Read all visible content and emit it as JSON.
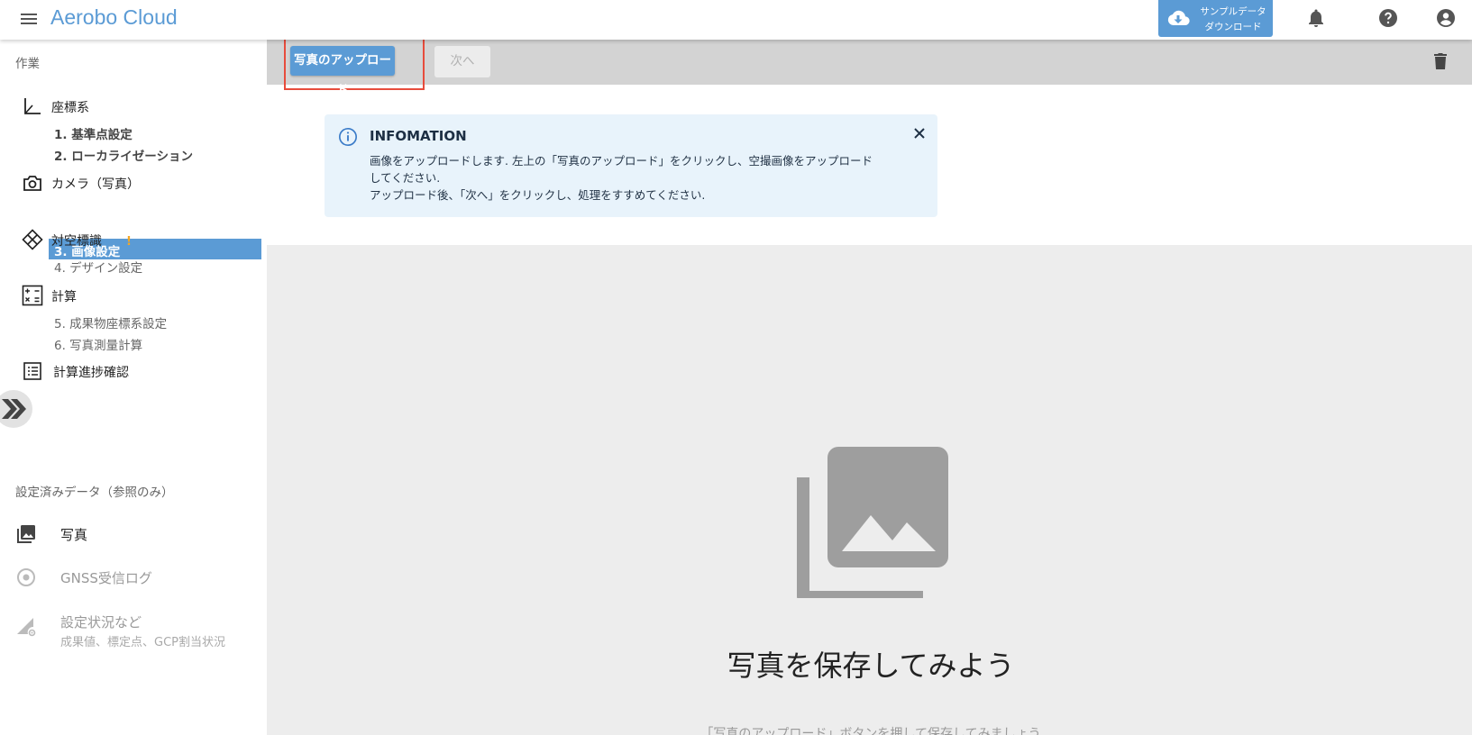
{
  "header": {
    "app_title": "Aerobo Cloud",
    "sample_line1": "サンプルデータ",
    "sample_line2": "ダウンロード"
  },
  "sidebar": {
    "work_label": "作業",
    "groups": [
      {
        "label": "座標系",
        "steps": [
          "1. 基準点設定",
          "2. ローカライゼーション"
        ]
      },
      {
        "label": "カメラ（写真）",
        "steps": [
          "3. 画像設定"
        ]
      },
      {
        "label": "対空標識",
        "steps": [
          "4. デザイン設定"
        ]
      },
      {
        "label": "計算",
        "steps": [
          "5. 成果物座標系設定",
          "6. 写真測量計算"
        ]
      }
    ],
    "active_warning": "!",
    "progress_label": "計算進捗確認",
    "reference_label": "設定済みデータ（参照のみ）",
    "reference_items": [
      {
        "label": "写真"
      },
      {
        "label": "GNSS受信ログ"
      },
      {
        "label": "設定状況など",
        "sub": "成果値、標定点、GCP割当状況"
      }
    ]
  },
  "toolbar": {
    "upload_label": "写真のアップロード",
    "next_label": "次へ"
  },
  "info": {
    "title": "INFOMATION",
    "line1": "画像をアップロードします. 左上の「写真のアップロード」をクリックし、空撮画像をアップロードしてください.",
    "line2": "アップロード後、「次へ」をクリックし、処理をすすめてください."
  },
  "empty_state": {
    "title": "写真を保存してみよう",
    "subtitle": "「写真のアップロード」ボタンを押して保存してみましょう"
  },
  "colors": {
    "accent": "#5b9bd5",
    "highlight": "#e74c3c",
    "warning": "#f5a623",
    "info_bg": "#e8f3fb"
  }
}
